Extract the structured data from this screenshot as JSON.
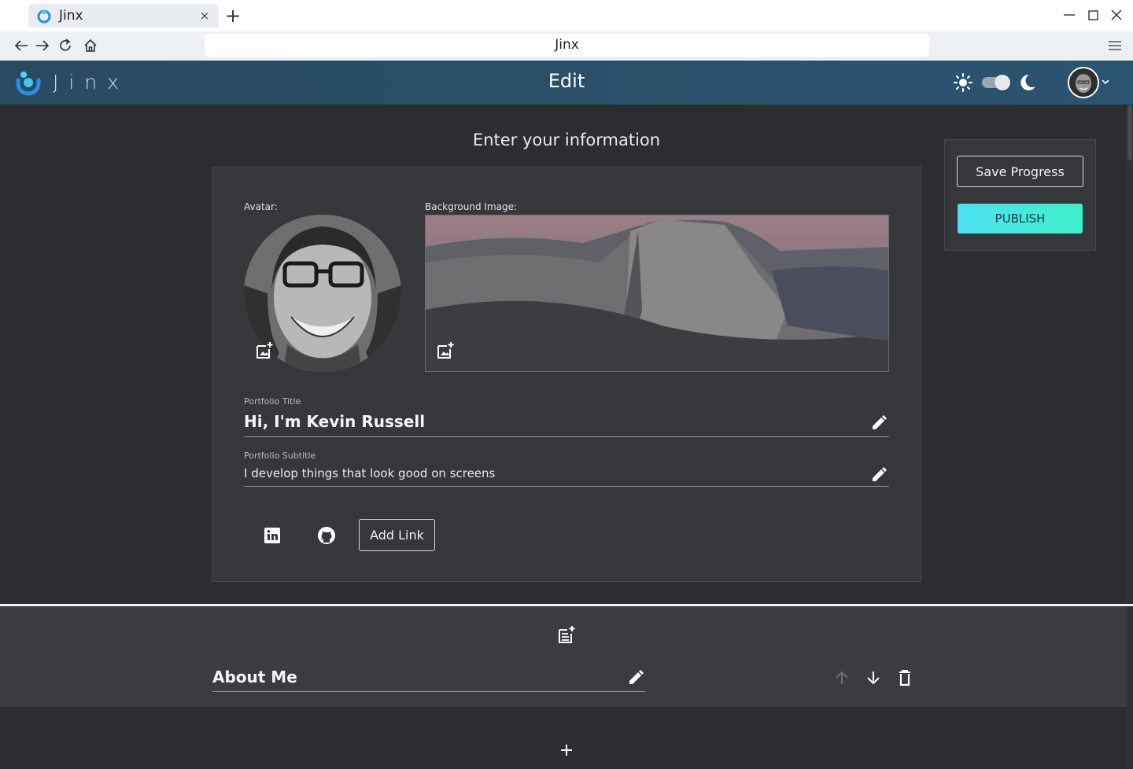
{
  "browser": {
    "tab_title": "Jinx",
    "tab_close": "×",
    "new_tab": "+",
    "url": "Jinx"
  },
  "header": {
    "logo_text": "Jinx",
    "page_title": "Edit",
    "theme_toggle_state": "dark"
  },
  "main": {
    "heading": "Enter your information",
    "avatar_label": "Avatar:",
    "background_label": "Background Image:",
    "portfolio_title_label": "Portfolio Title",
    "portfolio_title_value": "Hi, I'm Kevin Russell",
    "portfolio_subtitle_label": "Portfolio Subtitle",
    "portfolio_subtitle_value": "I develop things that look good on screens",
    "social_links": [
      {
        "icon": "linkedin-icon"
      },
      {
        "icon": "github-icon"
      }
    ],
    "add_link_label": "Add Link"
  },
  "side_panel": {
    "save_label": "Save Progress",
    "publish_label": "PUBLISH"
  },
  "sections": [
    {
      "title": "About Me"
    }
  ],
  "colors": {
    "background": "#2b2d30",
    "card": "#35373b",
    "header_start": "#2a4a62",
    "publish_accent": "#4ee0f0"
  }
}
